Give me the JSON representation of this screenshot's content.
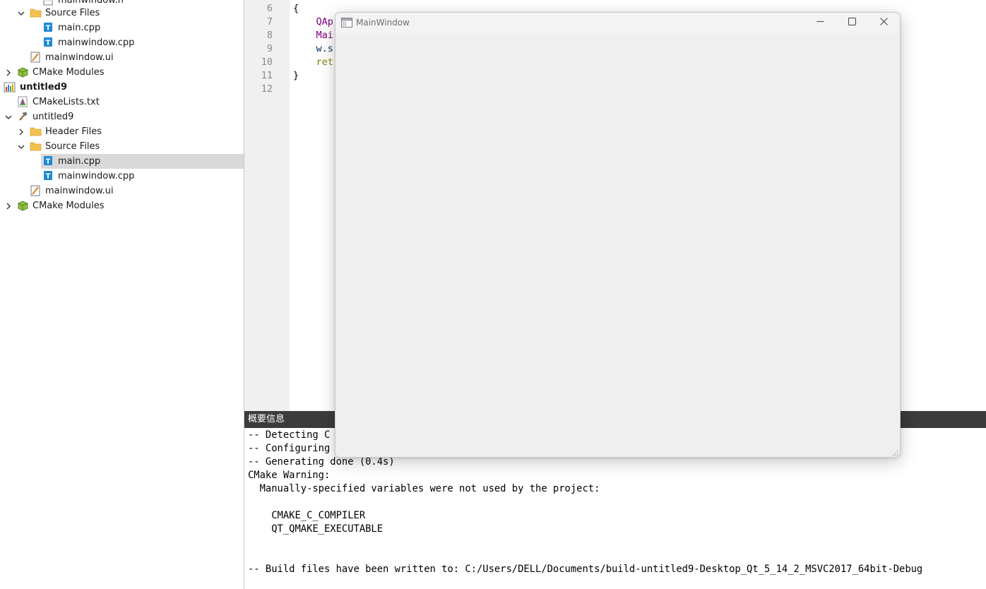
{
  "tree": {
    "items": [
      {
        "label": "mainwindow.h",
        "kind": "header-file"
      },
      {
        "label": "Source Files",
        "kind": "folder"
      },
      {
        "label": "main.cpp",
        "kind": "cpp-file"
      },
      {
        "label": "mainwindow.cpp",
        "kind": "cpp-file"
      },
      {
        "label": "mainwindow.ui",
        "kind": "ui-file"
      },
      {
        "label": "CMake Modules",
        "kind": "cmake-modules"
      },
      {
        "label": "untitled9",
        "kind": "project"
      },
      {
        "label": "CMakeLists.txt",
        "kind": "cmake-file"
      },
      {
        "label": "untitled9",
        "kind": "target"
      },
      {
        "label": "Header Files",
        "kind": "folder"
      },
      {
        "label": "Source Files",
        "kind": "folder"
      },
      {
        "label": "main.cpp",
        "kind": "cpp-file",
        "selected": true
      },
      {
        "label": "mainwindow.cpp",
        "kind": "cpp-file"
      },
      {
        "label": "mainwindow.ui",
        "kind": "ui-file"
      },
      {
        "label": "CMake Modules",
        "kind": "cmake-modules"
      }
    ]
  },
  "editor": {
    "line_numbers": [
      "6",
      "7",
      "8",
      "9",
      "10",
      "11",
      "12"
    ],
    "lines": [
      {
        "a": "{",
        "b": ""
      },
      {
        "a": "    ",
        "b": "QAp"
      },
      {
        "a": "    ",
        "b": "Mai"
      },
      {
        "a": "    ",
        "b": "w.s"
      },
      {
        "a": "    ",
        "b": "ret"
      },
      {
        "a": "}",
        "b": ""
      },
      {
        "a": "",
        "b": ""
      }
    ]
  },
  "output": {
    "title": "概要信息",
    "lines": [
      "-- Detecting C",
      "-- Configuring",
      "-- Generating done (0.4s)",
      "CMake Warning:",
      "  Manually-specified variables were not used by the project:",
      "",
      "    CMAKE_C_COMPILER",
      "    QT_QMAKE_EXECUTABLE",
      "",
      "",
      "-- Build files have been written to: C:/Users/DELL/Documents/build-untitled9-Desktop_Qt_5_14_2_MSVC2017_64bit-Debug"
    ]
  },
  "main_window": {
    "title": "MainWindow",
    "icons": {
      "minimize": "minimize-icon",
      "maximize": "maximize-icon",
      "close": "close-icon"
    }
  },
  "colors": {
    "selection": "#d9d9d9",
    "output_header": "#3c3c3c",
    "keyword_type": "#800080",
    "keyword_return": "#808000",
    "folder": "#f2c14e",
    "cpp_icon": "#1e88d6"
  }
}
